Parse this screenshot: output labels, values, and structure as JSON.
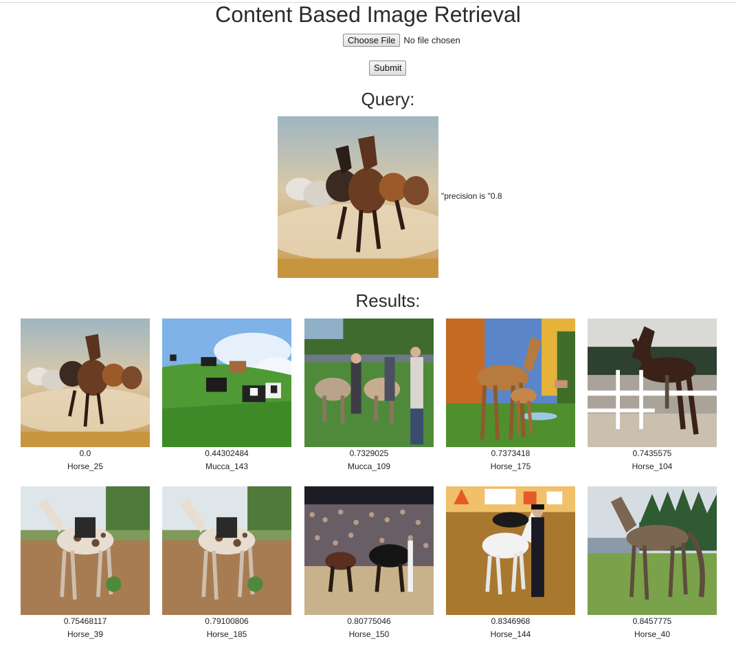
{
  "page": {
    "title": "Content Based Image Retrieval",
    "choose_file_label": "Choose File",
    "file_status": "No file chosen",
    "submit_label": "Submit",
    "query_heading": "Query:",
    "precision_text": "\"precision is \"0.8",
    "results_heading": "Results:"
  },
  "results": [
    {
      "score": "0.0",
      "label": "Horse_25"
    },
    {
      "score": "0.44302484",
      "label": "Mucca_143"
    },
    {
      "score": "0.7329025",
      "label": "Mucca_109"
    },
    {
      "score": "0.7373418",
      "label": "Horse_175"
    },
    {
      "score": "0.7435575",
      "label": "Horse_104"
    },
    {
      "score": "0.75468117",
      "label": "Horse_39"
    },
    {
      "score": "0.79100806",
      "label": "Horse_185"
    },
    {
      "score": "0.80775046",
      "label": "Horse_150"
    },
    {
      "score": "0.8346968",
      "label": "Horse_144"
    },
    {
      "score": "0.8457775",
      "label": "Horse_40"
    }
  ]
}
